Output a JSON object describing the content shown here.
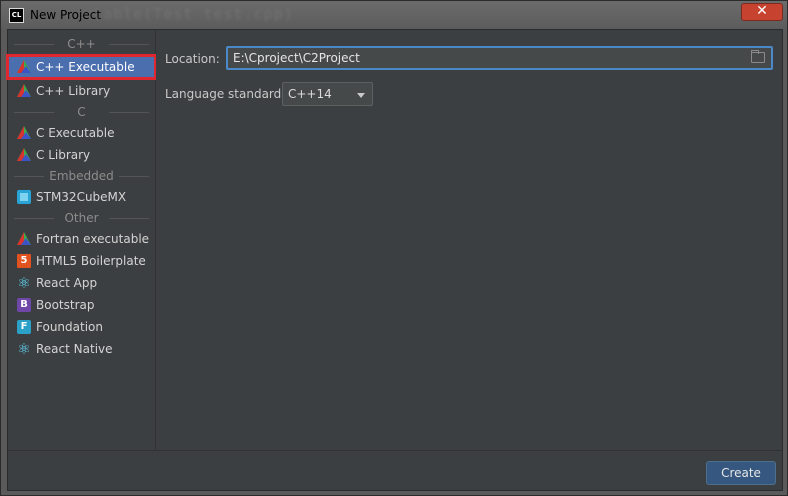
{
  "window": {
    "title": "New Project",
    "app_icon_text": "CL",
    "background_text": "...utable(Test test.cpp)",
    "close_glyph": "✕"
  },
  "sidebar": {
    "groups": [
      {
        "header": "C++",
        "items": [
          {
            "label": "C++ Executable",
            "icon": "cmake-triangle-icon",
            "selected": true
          },
          {
            "label": "C++ Library",
            "icon": "cmake-triangle-icon"
          }
        ]
      },
      {
        "header": "C",
        "items": [
          {
            "label": "C Executable",
            "icon": "cmake-triangle-icon"
          },
          {
            "label": "C Library",
            "icon": "cmake-triangle-icon"
          }
        ]
      },
      {
        "header": "Embedded",
        "items": [
          {
            "label": "STM32CubeMX",
            "icon": "cube-icon"
          }
        ]
      },
      {
        "header": "Other",
        "items": [
          {
            "label": "Fortran executable",
            "icon": "cmake-triangle-icon"
          },
          {
            "label": "HTML5 Boilerplate",
            "icon": "html5-icon",
            "glyph": "5"
          },
          {
            "label": "React App",
            "icon": "react-icon",
            "glyph": "⚛"
          },
          {
            "label": "Bootstrap",
            "icon": "bootstrap-icon",
            "glyph": "B"
          },
          {
            "label": "Foundation",
            "icon": "foundation-icon",
            "glyph": "F"
          },
          {
            "label": "React Native",
            "icon": "react-icon",
            "glyph": "⚛"
          }
        ]
      }
    ]
  },
  "form": {
    "location_label": "Location:",
    "location_value": "E:\\Cproject\\C2Project",
    "language_label": "Language standard:",
    "language_value": "C++14"
  },
  "footer": {
    "create_label": "Create"
  },
  "colors": {
    "accent": "#4b6eaf",
    "highlight_outline": "#e0262f",
    "panel_bg": "#3c3f41",
    "button_bg": "#365880"
  }
}
